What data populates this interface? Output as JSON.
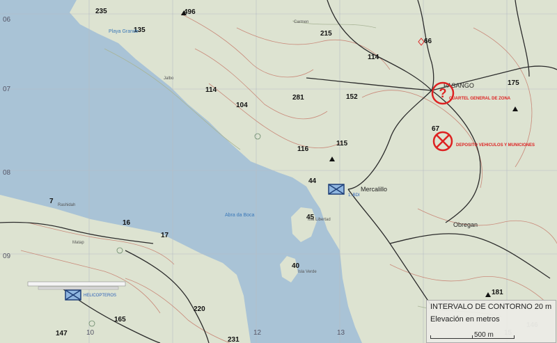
{
  "elevations": [
    "235",
    "496",
    "135",
    "215",
    "66",
    "114",
    "114",
    "281",
    "152",
    "104",
    "175",
    "67",
    "116",
    "115",
    "44",
    "7",
    "45",
    "16",
    "17",
    "40",
    "181",
    "220",
    "165",
    "147",
    "231",
    "146"
  ],
  "places": {
    "carmen": "Carmen",
    "playa_grande": "Playa Grande",
    "jalbo": "Jalbo",
    "pasango": "PASANGO",
    "mercalillo": "Mercalillo",
    "rashidah": "Rashidah",
    "obregan": "Obregan",
    "matap": "Matap",
    "isla_libertad": "Isla Libertad",
    "isla_verde": "Isla Verde",
    "abra_de_boca": "Abra da Boca"
  },
  "markers": {
    "hq": "CUARTEL GENERAL DE ZONA",
    "depot": "DEPOSITO VEHICULOS Y MUNICIONES",
    "unit_1": "1. BDI",
    "helipad": "HELICOPTEROS"
  },
  "grid_labels": {
    "rows": [
      "06",
      "07",
      "08",
      "09"
    ],
    "cols": [
      "10",
      "12",
      "13",
      "15"
    ]
  },
  "legend": {
    "contour_interval": "INTERVALO DE CONTORNO 20 m",
    "units": "Elevación en metros",
    "scale": "500 m"
  },
  "colors": {
    "water": "#a9c3d6",
    "land": "#dde3d1",
    "marker_red": "#dd2222",
    "marker_blue": "#2a60b8"
  }
}
